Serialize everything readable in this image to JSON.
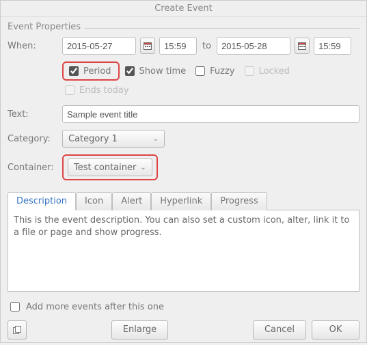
{
  "title": "Create Event",
  "fieldset_label": "Event Properties",
  "when": {
    "label": "When:",
    "start_date": "2015-05-27",
    "start_time": "15:59",
    "to": "to",
    "end_date": "2015-05-28",
    "end_time": "15:59"
  },
  "options": {
    "period": "Period",
    "show_time": "Show time",
    "fuzzy": "Fuzzy",
    "locked": "Locked",
    "ends_today": "Ends today"
  },
  "text": {
    "label": "Text:",
    "value": "Sample event title"
  },
  "category": {
    "label": "Category:",
    "value": "Category 1"
  },
  "container": {
    "label": "Container:",
    "value": "Test container"
  },
  "tabs": {
    "description": "Description",
    "icon": "Icon",
    "alert": "Alert",
    "hyperlink": "Hyperlink",
    "progress": "Progress"
  },
  "description_value": "This is the event description. You can also set a custom icon, alter, link it to a file or page and show progress.",
  "add_more": "Add more events after this one",
  "buttons": {
    "enlarge": "Enlarge",
    "cancel": "Cancel",
    "ok": "OK"
  }
}
